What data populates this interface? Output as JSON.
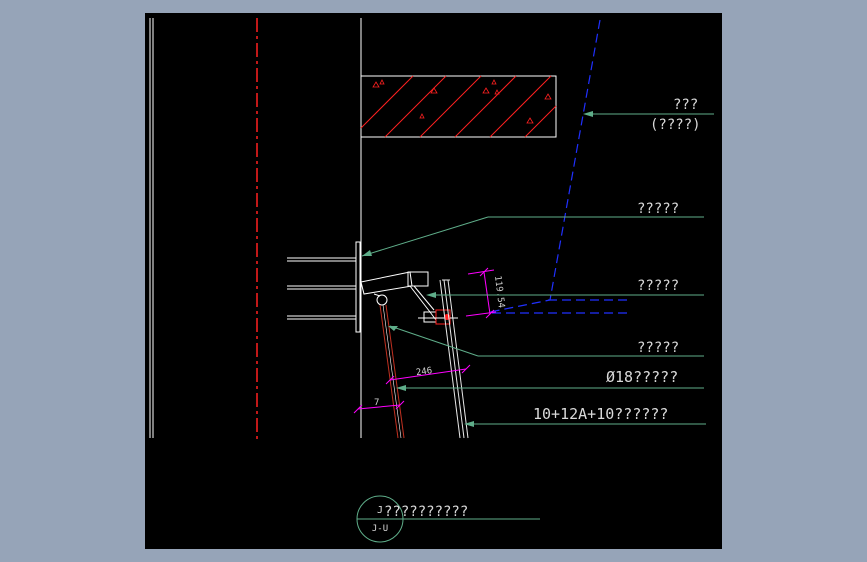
{
  "viewport": {
    "background_color": "#96a4b8",
    "canvas_color": "#000000"
  },
  "colors": {
    "line_white": "#ffffff",
    "centerline_red": "#ff2020",
    "hatch_red": "#ff2020",
    "leader_green": "#5fae8a",
    "label_color": "#d9d9d9",
    "dimension_magenta": "#ff00ff",
    "dashed_blue": "#2030ff",
    "mullion_red": "#c03020",
    "glass_white": "#e8e8e8"
  },
  "labels": [
    {
      "id": "label-1a",
      "text": "???"
    },
    {
      "id": "label-1b",
      "text": "(????)"
    },
    {
      "id": "label-2",
      "text": "?????"
    },
    {
      "id": "label-3",
      "text": "?????"
    },
    {
      "id": "label-4",
      "text": "?????"
    },
    {
      "id": "label-5",
      "text": "Ø18?????"
    },
    {
      "id": "label-6",
      "text": "10+12A+10??????"
    }
  ],
  "dimensions": {
    "angled": "119.54",
    "horizontal": "246",
    "offset": "7"
  },
  "title_block": {
    "number": "J",
    "reference": "J-U",
    "title": "??????????"
  }
}
